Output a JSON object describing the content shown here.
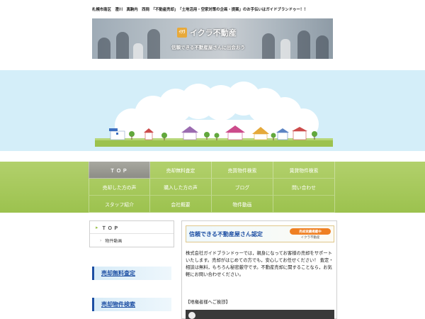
{
  "header": {
    "tagline": "札幌市南区　澄川　真駒内　西岡　「不動産売却」　「土地活用・空家対策の企画・提案」のお手伝いはガイドブランドゥー！！"
  },
  "banner": {
    "logo_mark": "ｲｸﾗ",
    "logo_text": "イクラ不動産",
    "slogan": "信頼できる不動産屋さんに出会おう"
  },
  "nav": {
    "items": [
      {
        "label": "ＴＯＰ",
        "active": true
      },
      {
        "label": "売却無料査定",
        "active": false
      },
      {
        "label": "売買物件検索",
        "active": false
      },
      {
        "label": "賃貸物件検索",
        "active": false
      },
      {
        "label": "売却した方の声",
        "active": false
      },
      {
        "label": "購入した方の声",
        "active": false
      },
      {
        "label": "ブログ",
        "active": false
      },
      {
        "label": "問い合わせ",
        "active": false
      },
      {
        "label": "スタッフ紹介",
        "active": false
      },
      {
        "label": "会社概要",
        "active": false
      },
      {
        "label": "物件動画",
        "active": false
      },
      {
        "label": "",
        "active": false
      }
    ]
  },
  "sidebar": {
    "top_label": "ＴＯＰ",
    "sub_label": "物件動画",
    "banners": [
      "売却無料査定",
      "売却物件検索"
    ]
  },
  "main": {
    "cert_title": "信頼できる不動産屋さん認定",
    "cert_badge": "売却実績掲載中",
    "cert_brand": "イクラ不動産",
    "intro": "株式会社ガイドブランドゥーでは，親身になってお客様の売却をサポートいたします。売却がはじめての方でも，安心してお任せください！ 査定・相談は無料，もちろん秘密厳守です。不動産売却に関することなら，お気軽にお問い合わせください。",
    "greeting": "【地権者様へご挨拶】"
  },
  "colors": {
    "nav_green": "#9cc24e",
    "sky": "#d4eef9",
    "link_blue": "#1d4fa3",
    "badge_orange": "#ef7f22"
  }
}
